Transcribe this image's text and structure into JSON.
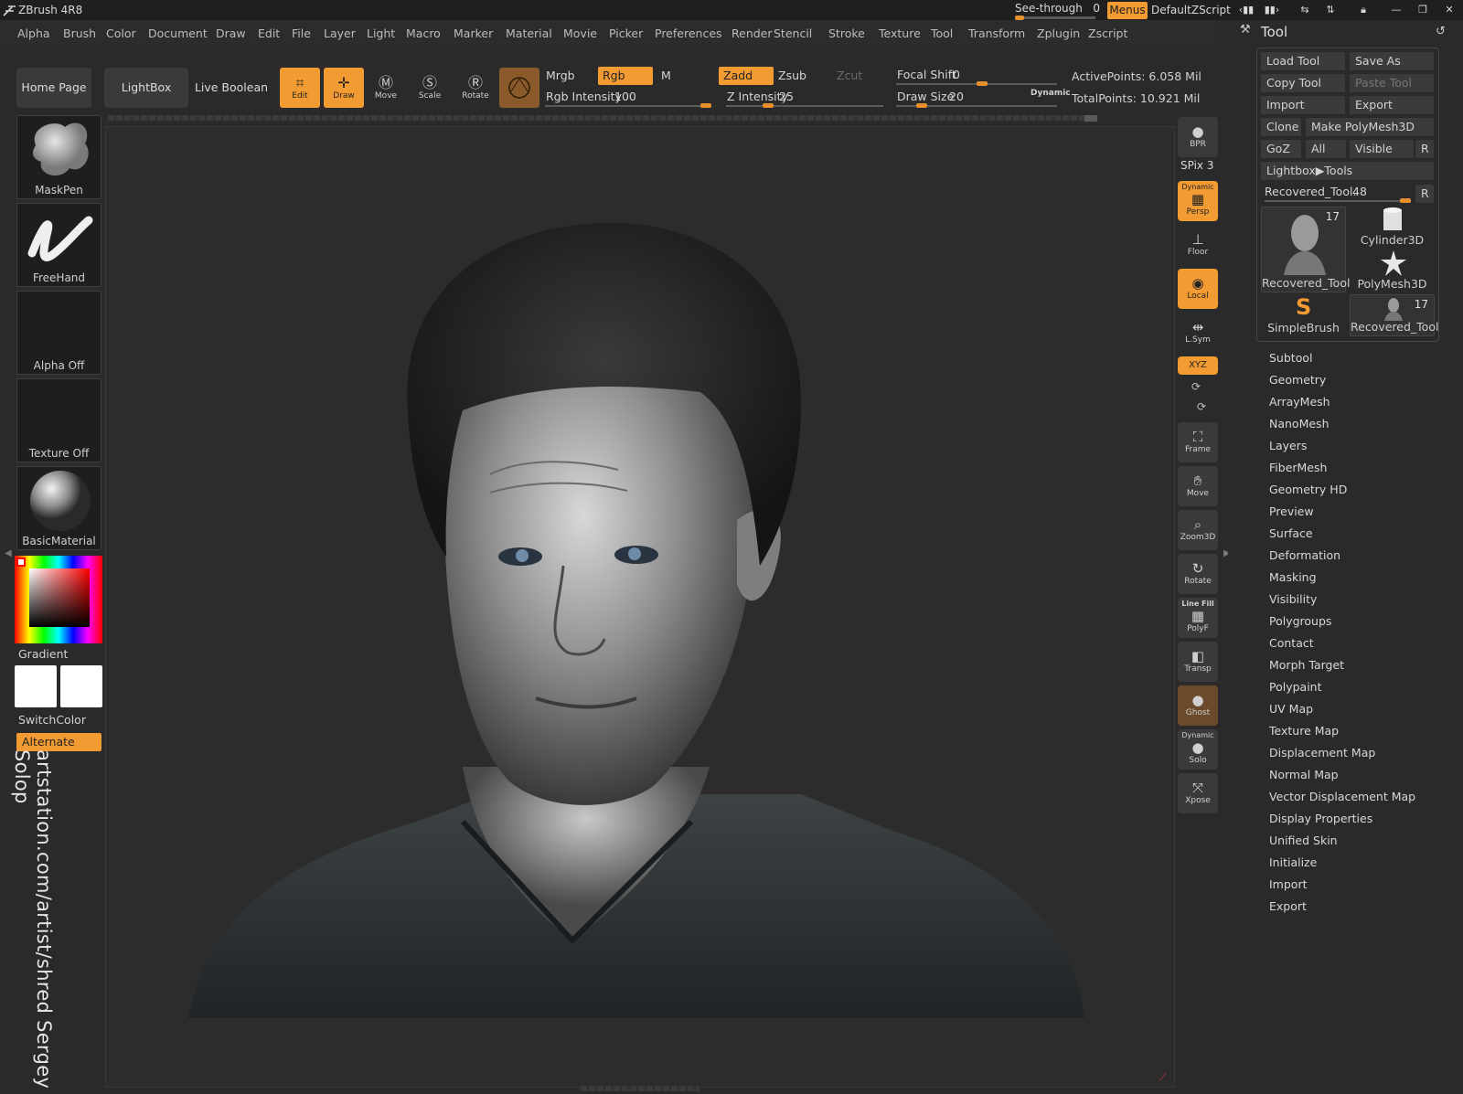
{
  "window": {
    "title": "ZBrush 4R8"
  },
  "titlebar": {
    "see_through_label": "See-through",
    "see_through_value": "0",
    "menus_label": "Menus",
    "script_name": "DefaultZScript"
  },
  "menubar": [
    "Alpha",
    "Brush",
    "Color",
    "Document",
    "Draw",
    "Edit",
    "File",
    "Layer",
    "Light",
    "Macro",
    "Marker",
    "Material",
    "Movie",
    "Picker",
    "Preferences",
    "Render",
    "Stencil",
    "Stroke",
    "Texture",
    "Tool",
    "Transform",
    "Zplugin",
    "Zscript"
  ],
  "toolbar": {
    "home_page": "Home Page",
    "lightbox": "LightBox",
    "live_boolean": "Live Boolean",
    "modes": {
      "edit": "Edit",
      "draw": "Draw",
      "move": "Move",
      "scale": "Scale",
      "rotate": "Rotate"
    },
    "mrgb": "Mrgb",
    "rgb": "Rgb",
    "m": "M",
    "zadd": "Zadd",
    "zsub": "Zsub",
    "zcut": "Zcut",
    "rgb_intensity_label": "Rgb Intensity",
    "rgb_intensity": "100",
    "rgb_intensity_level": 1.0,
    "z_intensity_label": "Z Intensity",
    "z_intensity": "25",
    "z_intensity_level": 0.25,
    "focal_shift_label": "Focal Shift",
    "focal_shift": "0",
    "draw_size_label": "Draw Size",
    "draw_size": "20",
    "dynamic_label": "Dynamic",
    "active_points": "ActivePoints: 6.058 Mil",
    "total_points": "TotalPoints: 10.921 Mil"
  },
  "left_shelf": {
    "brush": "MaskPen",
    "stroke": "FreeHand",
    "alpha": "Alpha Off",
    "texture": "Texture Off",
    "material": "BasicMaterial",
    "gradient": "Gradient",
    "switch_color": "SwitchColor",
    "alternate": "Alternate"
  },
  "right_shelf": {
    "bpr": "BPR",
    "spix_label": "SPix",
    "spix_value": "3",
    "persp_top": "Dynamic",
    "persp": "Persp",
    "floor": "Floor",
    "local": "Local",
    "lsym": "L.Sym",
    "xyz": "XYZ",
    "frame": "Frame",
    "move": "Move",
    "zoom3d": "Zoom3D",
    "rotate": "Rotate",
    "linefill": "Line Fill",
    "polyf": "PolyF",
    "transp": "Transp",
    "ghost": "Ghost",
    "solo_top": "Dynamic",
    "solo": "Solo",
    "xpose": "Xpose"
  },
  "tool_panel": {
    "title": "Tool",
    "load_tool": "Load Tool",
    "save_as": "Save As",
    "copy_tool": "Copy Tool",
    "paste_tool": "Paste Tool",
    "import": "Import",
    "export": "Export",
    "clone": "Clone",
    "make_polymesh": "Make PolyMesh3D",
    "goz": "GoZ",
    "all": "All",
    "visible": "Visible",
    "r": "R",
    "lightbox_tools": "Lightbox▶Tools",
    "current_tool_label": "Recovered_Tool.",
    "current_tool_value": "48",
    "thumbs": [
      {
        "label": "Recovered_Tool",
        "count": "17"
      },
      {
        "label": "Cylinder3D",
        "count": ""
      },
      {
        "label": "PolyMesh3D",
        "count": ""
      },
      {
        "label": "SimpleBrush",
        "count": ""
      },
      {
        "label": "Recovered_Tool",
        "count": "17"
      }
    ],
    "subpalettes": [
      "Subtool",
      "Geometry",
      "ArrayMesh",
      "NanoMesh",
      "Layers",
      "FiberMesh",
      "Geometry HD",
      "Preview",
      "Surface",
      "Deformation",
      "Masking",
      "Visibility",
      "Polygroups",
      "Contact",
      "Morph Target",
      "Polypaint",
      "UV Map",
      "Texture Map",
      "Displacement Map",
      "Normal Map",
      "Vector Displacement Map",
      "Display Properties",
      "Unified Skin",
      "Initialize",
      "Import",
      "Export"
    ]
  },
  "watermark": "artstation.com/artist/shred Sergey Solop",
  "colors": {
    "accent": "#f29b32",
    "panel": "#3a3a3a",
    "bg": "#2a2a2a"
  }
}
